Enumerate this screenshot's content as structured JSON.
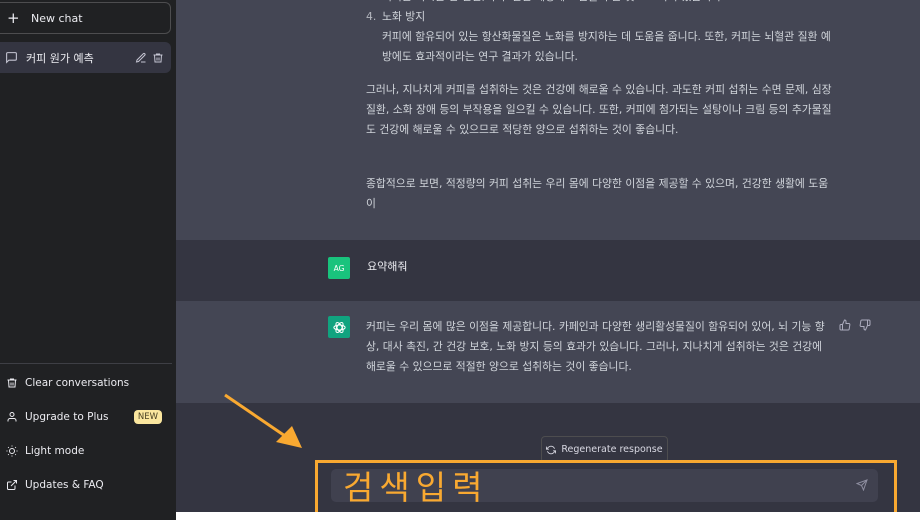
{
  "sidebar": {
    "new_chat_label": "New chat",
    "conversations": [
      {
        "title": "커피 원가 예측",
        "active": true
      }
    ],
    "menu": [
      {
        "icon": "trash-icon",
        "label": "Clear conversations"
      },
      {
        "icon": "user-icon",
        "label": "Upgrade to Plus",
        "badge": "NEW"
      },
      {
        "icon": "sun-icon",
        "label": "Light mode"
      },
      {
        "icon": "external-link-icon",
        "label": "Updates & FAQ"
      }
    ]
  },
  "conversation": {
    "previous_response": {
      "cut_line": "커피는 역시는 한 잔만, 구주 잔잔 계상에 도움을 주는 것으로 나와 있습니다.",
      "list_item": {
        "number": "4.",
        "heading": "노화 방지",
        "body": "커피에 함유되어 있는 항산화물질은 노화를 방지하는 데 도움을 줍니다. 또한, 커피는 뇌혈관 질환 예방에도 효과적이라는 연구 결과가 있습니다."
      },
      "paragraph_1": "그러나, 지나치게 커피를 섭취하는 것은 건강에 해로울 수 있습니다. 과도한 커피 섭취는 수면 문제, 심장 질환, 소화 장애 등의 부작용을 일으킬 수 있습니다. 또한, 커피에 첨가되는 설탕이나 크림 등의 추가물질도 건강에 해로울 수 있으므로 적당한 양으로 섭취하는 것이 좋습니다.",
      "paragraph_2": "종합적으로 보면, 적정량의 커피 섭취는 우리 몸에 다양한 이점을 제공할 수 있으며, 건강한 생활에 도움이"
    },
    "user_message": {
      "avatar": "AG",
      "text": "요약해줘"
    },
    "assistant_message": {
      "text": "커피는 우리 몸에 많은 이점을 제공합니다. 카페인과 다양한 생리활성물질이 함유되어 있어, 뇌 기능 향상, 대사 촉진, 간 건강 보호, 노화 방지 등의 효과가 있습니다. 그러나, 지나치게 섭취하는 것은 건강에 해로울 수 있으므로 적절한 양으로 섭취하는 것이 좋습니다."
    }
  },
  "composer": {
    "regenerate_label": "Regenerate response",
    "input_value": "검색입력",
    "annotation_color": "#f9a931"
  },
  "colors": {
    "sidebar_bg": "#202123",
    "main_bg": "#343541",
    "assistant_bg": "#444654",
    "user_avatar": "#19c37d",
    "gpt_avatar": "#10a37f",
    "badge_bg": "#fae69e"
  }
}
